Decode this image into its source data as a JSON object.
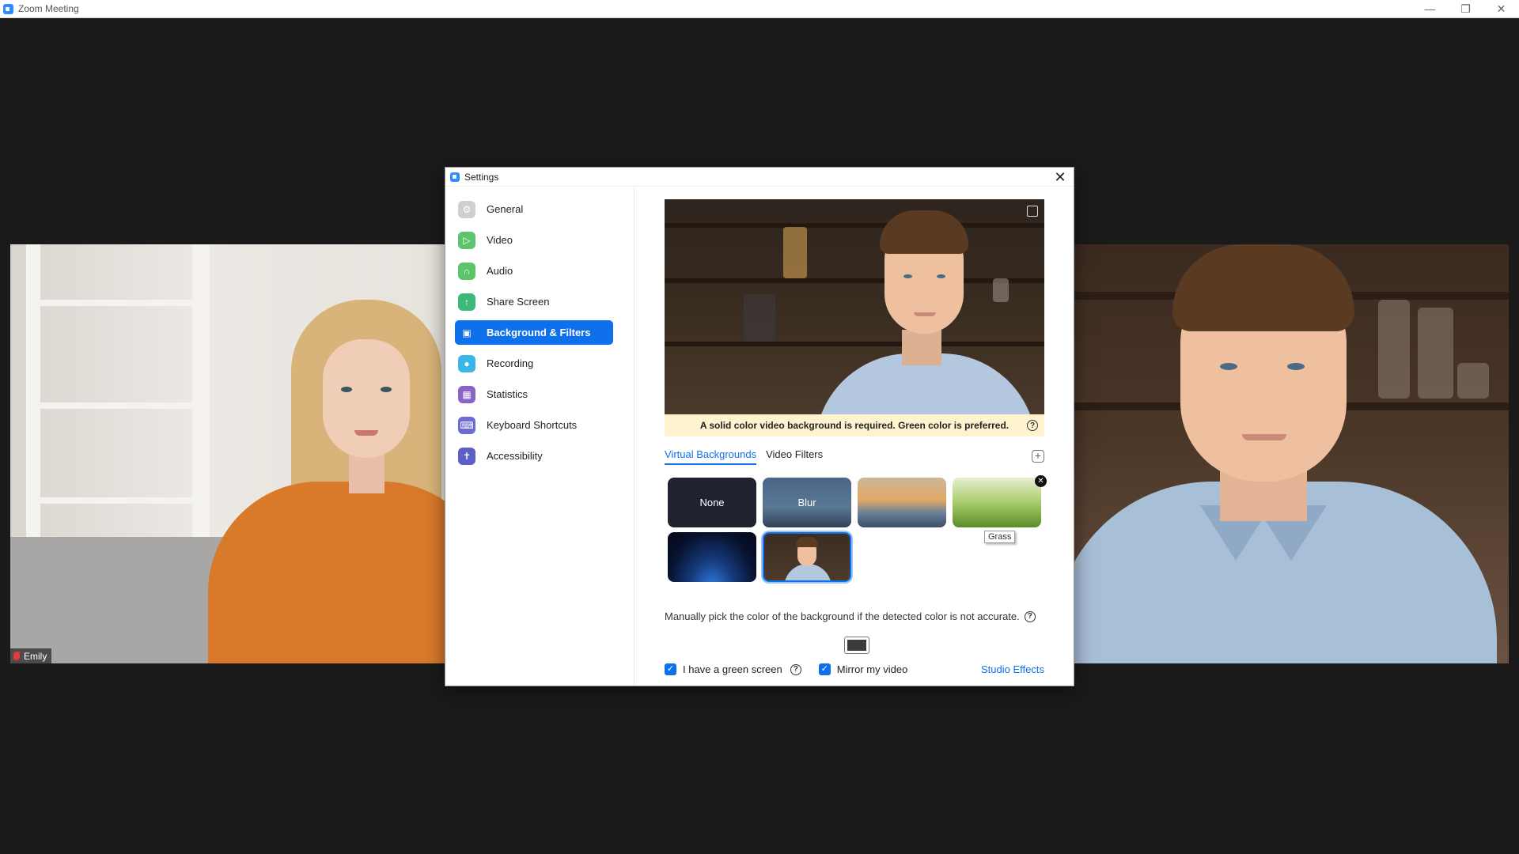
{
  "window": {
    "title": "Zoom Meeting"
  },
  "participants": [
    {
      "name": "Emily",
      "muted": true
    }
  ],
  "dialog": {
    "title": "Settings",
    "nav": [
      {
        "label": "General",
        "icon": "gear-icon",
        "color": "#cfcfcf"
      },
      {
        "label": "Video",
        "icon": "video-camera-icon",
        "color": "#5cc46a"
      },
      {
        "label": "Audio",
        "icon": "headphones-icon",
        "color": "#5cc46a"
      },
      {
        "label": "Share Screen",
        "icon": "share-screen-icon",
        "color": "#3cb878"
      },
      {
        "label": "Background & Filters",
        "icon": "person-card-icon",
        "color": "#0e71eb",
        "active": true
      },
      {
        "label": "Recording",
        "icon": "record-icon",
        "color": "#38b6e8"
      },
      {
        "label": "Statistics",
        "icon": "bar-chart-icon",
        "color": "#8a63c8"
      },
      {
        "label": "Keyboard Shortcuts",
        "icon": "keyboard-icon",
        "color": "#6c6bd6"
      },
      {
        "label": "Accessibility",
        "icon": "accessibility-icon",
        "color": "#5b5fc7"
      }
    ],
    "warning": "A solid color video background is required. Green color is preferred.",
    "tabs": [
      {
        "label": "Virtual Backgrounds",
        "active": true
      },
      {
        "label": "Video Filters",
        "active": false
      }
    ],
    "backgrounds": [
      {
        "label": "None",
        "style": "none"
      },
      {
        "label": "Blur",
        "style": "blur"
      },
      {
        "label": "",
        "style": "bridge"
      },
      {
        "label": "",
        "style": "grass",
        "tooltip": "Grass"
      },
      {
        "label": "",
        "style": "space"
      },
      {
        "label": "",
        "style": "room",
        "selected": true
      }
    ],
    "pick_text": "Manually pick the color of the background if the detected color is not accurate.",
    "picked_color": "#3a3a3a",
    "green_screen_label": "I have a green screen",
    "green_screen_checked": true,
    "mirror_label": "Mirror my video",
    "mirror_checked": true,
    "studio_effects_label": "Studio Effects"
  },
  "colors": {
    "accent": "#0e71eb",
    "warning_bg": "#fdf3cf"
  }
}
